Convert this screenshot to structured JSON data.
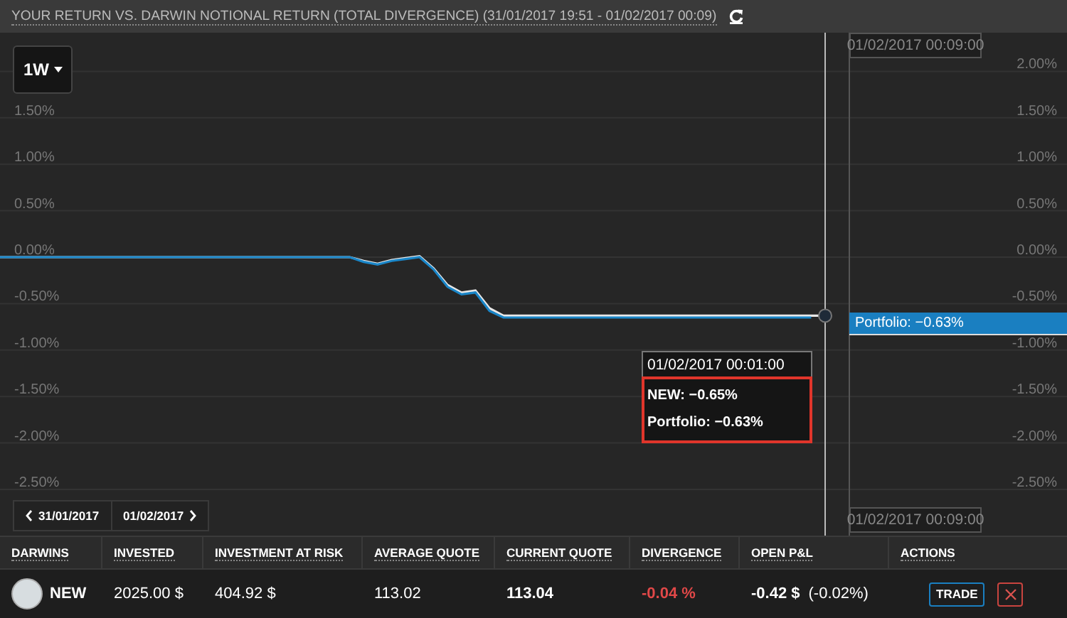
{
  "header": {
    "title": "YOUR RETURN VS. DARWIN NOTIONAL RETURN (TOTAL DIVERGENCE) (31/01/2017 19:51 - 01/02/2017 00:09)"
  },
  "chart": {
    "range_button": "1W",
    "left_axis_labels": [
      "1.50%",
      "1.00%",
      "0.50%",
      "0.00%",
      "-0.50%",
      "-1.00%",
      "-1.50%",
      "-2.00%",
      "-2.50%"
    ],
    "crosshair_label_top": "01/02/2017 00:09:00",
    "crosshair_label_bottom": "01/02/2017 00:09:00",
    "series_tag": "Portfolio: −0.63%",
    "tooltip": {
      "title": "01/02/2017 00:01:00",
      "lines": [
        "NEW: −0.65%",
        "Portfolio: −0.63%"
      ]
    },
    "nav": {
      "previous": "31/01/2017",
      "next": "01/02/2017"
    },
    "chart_data": {
      "type": "line",
      "grid": true,
      "ylim": [
        -2.5,
        2
      ],
      "yticks": [
        {
          "value": 2,
          "label": "2.00%"
        },
        {
          "value": 1.5,
          "label": "1.50%"
        },
        {
          "value": 1,
          "label": "1.00%"
        },
        {
          "value": 0.5,
          "label": "0.50%"
        },
        {
          "value": 0,
          "label": "0.00%"
        },
        {
          "value": -0.5,
          "label": "-0.50%"
        },
        {
          "value": -1,
          "label": "-1.00%"
        },
        {
          "value": -1.5,
          "label": "-1.50%"
        },
        {
          "value": -2,
          "label": "-2.00%"
        },
        {
          "value": -2.5,
          "label": "-2.50%"
        }
      ],
      "series": [
        {
          "color": "#e8e8e8",
          "values": [
            0,
            0,
            0,
            0,
            0,
            0,
            0,
            0,
            0,
            0,
            0,
            0,
            0,
            0,
            0,
            0,
            0,
            0,
            0,
            0,
            0,
            0,
            0,
            0,
            0,
            0,
            -0.04,
            -0.07,
            -0.03,
            -0.01,
            0.01,
            -0.12,
            -0.3,
            -0.38,
            -0.36,
            -0.55,
            -0.63,
            -0.63,
            -0.63,
            -0.63,
            -0.63,
            -0.63,
            -0.63,
            -0.63,
            -0.63,
            -0.63,
            -0.63,
            -0.63,
            -0.63,
            -0.63,
            -0.63,
            -0.63,
            -0.63,
            -0.63,
            -0.63,
            -0.63,
            -0.63,
            -0.63,
            -0.63,
            -0.63
          ]
        },
        {
          "color": "#1a86c8",
          "values": [
            0,
            0,
            0,
            0,
            0,
            0,
            0,
            0,
            0,
            0,
            0,
            0,
            0,
            0,
            0,
            0,
            0,
            0,
            0,
            0,
            0,
            0,
            0,
            0,
            0,
            0,
            -0.05,
            -0.08,
            -0.04,
            -0.02,
            0,
            -0.13,
            -0.32,
            -0.4,
            -0.38,
            -0.58,
            -0.65,
            -0.65,
            -0.65,
            -0.65,
            -0.65,
            -0.65,
            -0.65,
            -0.65,
            -0.65,
            -0.65,
            -0.65,
            -0.65,
            -0.65,
            -0.65,
            -0.65,
            -0.65,
            -0.65,
            -0.65,
            -0.65,
            -0.65,
            -0.65,
            -0.65,
            -0.65,
            null
          ]
        }
      ]
    }
  },
  "table": {
    "columns": [
      "DARWINS",
      "INVESTED",
      "INVESTMENT AT RISK",
      "AVERAGE QUOTE",
      "CURRENT QUOTE",
      "DIVERGENCE",
      "OPEN P&L",
      "ACTIONS"
    ],
    "rows": [
      {
        "darwin": "NEW",
        "invested": "2025.00 $",
        "at_risk": "404.92 $",
        "average_quote": "113.02",
        "current_quote": "113.04",
        "divergence": "-0.04 %",
        "open_pl": "-0.42 $",
        "open_pl_percent": "(-0.02%)",
        "trade": "TRADE"
      }
    ]
  }
}
